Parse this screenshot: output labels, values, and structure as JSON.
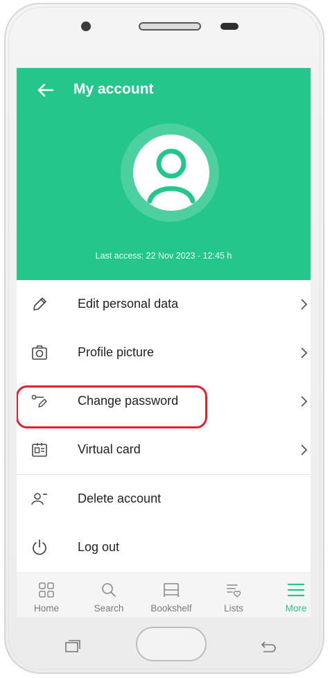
{
  "header": {
    "title": "My account",
    "last_access": "Last access: 22 Nov 2023 - 12:45 h",
    "accent_color": "#25c68b"
  },
  "menu": {
    "items": [
      {
        "label": "Edit personal data",
        "icon": "pencil-icon"
      },
      {
        "label": "Profile picture",
        "icon": "camera-icon"
      },
      {
        "label": "Change password",
        "icon": "key-icon",
        "highlighted": true
      },
      {
        "label": "Virtual card",
        "icon": "id-card-icon"
      },
      {
        "label": "Delete account",
        "icon": "remove-user-icon"
      },
      {
        "label": "Log out",
        "icon": "power-icon"
      }
    ]
  },
  "bottom_nav": {
    "items": [
      {
        "label": "Home",
        "icon": "grid-icon"
      },
      {
        "label": "Search",
        "icon": "search-icon"
      },
      {
        "label": "Bookshelf",
        "icon": "bookshelf-icon"
      },
      {
        "label": "Lists",
        "icon": "list-heart-icon"
      },
      {
        "label": "More",
        "icon": "menu-icon",
        "active": true
      }
    ]
  },
  "highlight_color": "#e0202a"
}
